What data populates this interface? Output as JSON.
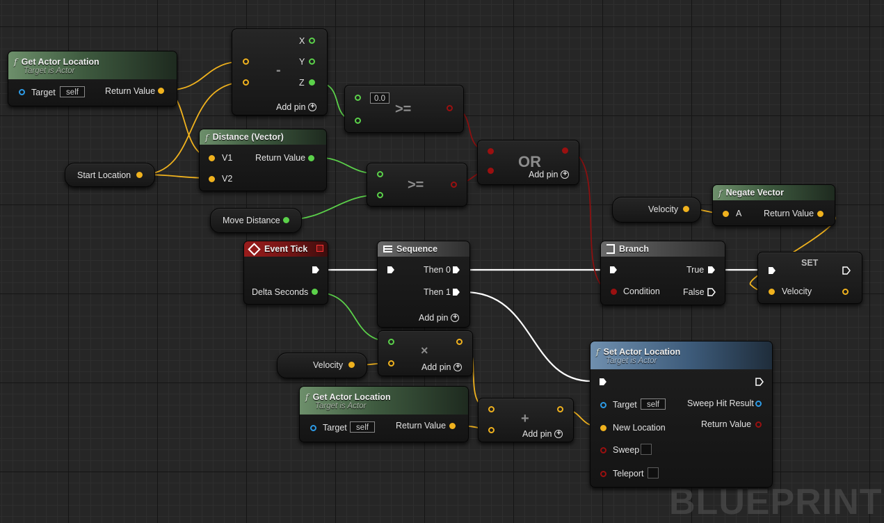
{
  "watermark": "BLUEPRINT",
  "colors": {
    "exec": "#ffffff",
    "float": "#5bd14a",
    "vector": "#f0b21e",
    "bool": "#9a1010",
    "object": "#2d9be6"
  },
  "nodes": {
    "get_actor_location_1": {
      "title": "Get Actor Location",
      "subtitle": "Target is Actor",
      "target_label": "Target",
      "target_value": "self",
      "return_label": "Return Value"
    },
    "subtract": {
      "op": "-",
      "x_label": "X",
      "y_label": "Y",
      "z_label": "Z",
      "add_pin": "Add pin"
    },
    "compare_z": {
      "value": "0.0",
      "op": ">="
    },
    "distance": {
      "title": "Distance (Vector)",
      "v1": "V1",
      "v2": "V2",
      "return_label": "Return Value"
    },
    "start_location": {
      "label": "Start Location"
    },
    "compare_dist": {
      "op": ">="
    },
    "or": {
      "op": "OR",
      "add_pin": "Add pin"
    },
    "move_distance": {
      "label": "Move Distance"
    },
    "event_tick": {
      "title": "Event Tick",
      "delta": "Delta Seconds"
    },
    "sequence": {
      "title": "Sequence",
      "then0": "Then 0",
      "then1": "Then 1",
      "add_pin": "Add pin"
    },
    "branch": {
      "title": "Branch",
      "condition": "Condition",
      "true_label": "True",
      "false_label": "False"
    },
    "velocity_get_1": {
      "label": "Velocity"
    },
    "negate": {
      "title": "Negate Vector",
      "a": "A",
      "return_label": "Return Value"
    },
    "set": {
      "title": "SET",
      "velocity": "Velocity"
    },
    "velocity_get_2": {
      "label": "Velocity"
    },
    "multiply": {
      "op": "×",
      "add_pin": "Add pin"
    },
    "get_actor_location_2": {
      "title": "Get Actor Location",
      "subtitle": "Target is Actor",
      "target_label": "Target",
      "target_value": "self",
      "return_label": "Return Value"
    },
    "add": {
      "op": "+",
      "add_pin": "Add pin"
    },
    "set_actor_location": {
      "title": "Set Actor Location",
      "subtitle": "Target is Actor",
      "target_label": "Target",
      "target_value": "self",
      "new_location": "New Location",
      "sweep": "Sweep",
      "teleport": "Teleport",
      "sweep_hit": "Sweep Hit Result",
      "return_label": "Return Value"
    }
  }
}
